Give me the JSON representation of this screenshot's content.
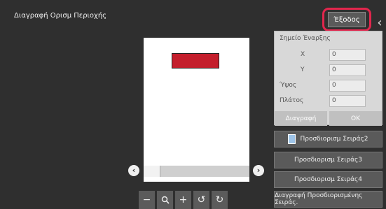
{
  "header": {
    "title": "Διαγραφή Ορισμ Περιοχής",
    "exit_label": "Έξοδος"
  },
  "panel": {
    "title": "Σημείο Έναρξης",
    "x_label": "X",
    "x_value": "0",
    "y_label": "Y",
    "y_value": "0",
    "height_label": "Ύψος",
    "height_value": "0",
    "width_label": "Πλάτος",
    "width_value": "0",
    "delete_label": "Διαγραφή",
    "ok_label": "OK"
  },
  "sidebar": {
    "items": [
      {
        "label": "Προσδιορισμ Σειράς2"
      },
      {
        "label": "Προσδιορισμ Σειράς3"
      },
      {
        "label": "Προσδιορισμ Σειράς4"
      },
      {
        "label": "Διαγραφή Προσδιορισμένης Σειράς."
      }
    ]
  },
  "zoom": {
    "minus": "−",
    "search": "🔍",
    "plus": "+",
    "rotate_left": "↺",
    "rotate_right": "↻"
  },
  "colors": {
    "accent": "#e2264d",
    "region": "#c41e2c",
    "background": "#2f2f2f"
  }
}
